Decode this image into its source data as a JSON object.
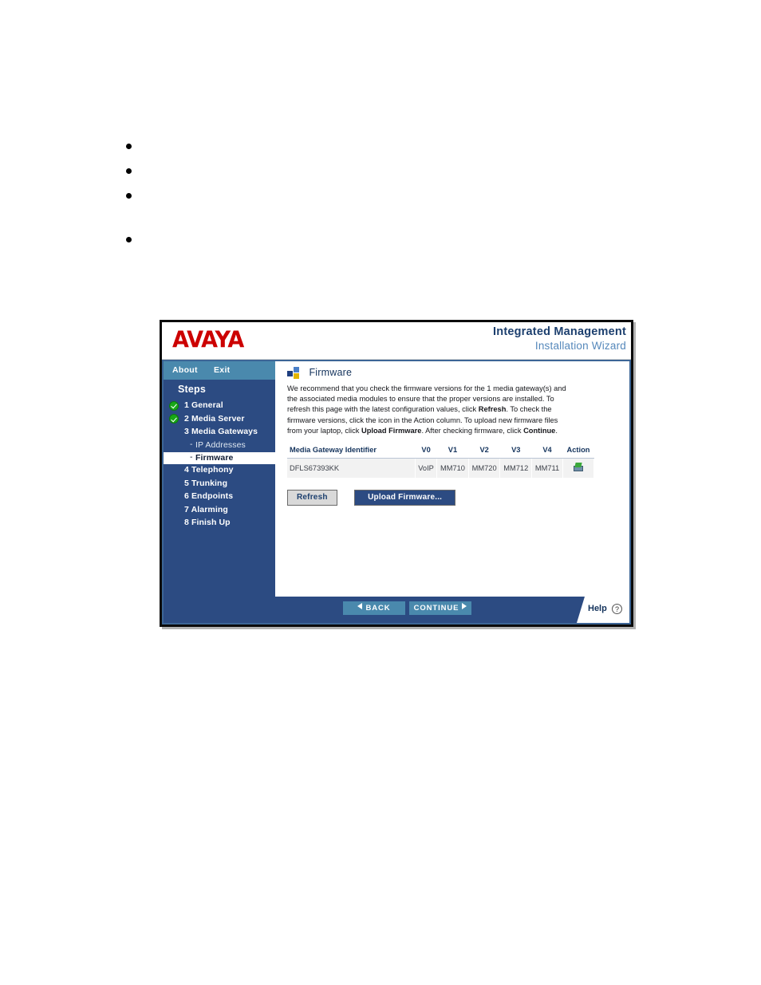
{
  "document": {
    "bullets": [
      "",
      "",
      "",
      ""
    ]
  },
  "window": {
    "brand": {
      "logo_text": "AVAYA",
      "product_line1": "Integrated Management",
      "product_line2": "Installation Wizard"
    },
    "topnav": {
      "about_label": "About",
      "exit_label": "Exit"
    },
    "sidebar": {
      "heading": "Steps",
      "items": [
        {
          "label": "1 General",
          "state": "complete",
          "sub": false
        },
        {
          "label": "2 Media Server",
          "state": "complete",
          "sub": false
        },
        {
          "label": "3 Media Gateways",
          "state": "normal",
          "sub": false
        },
        {
          "label": "IP Addresses",
          "state": "normal",
          "sub": true
        },
        {
          "label": "Firmware",
          "state": "active",
          "sub": true
        },
        {
          "label": "4 Telephony",
          "state": "normal",
          "sub": false
        },
        {
          "label": "5 Trunking",
          "state": "normal",
          "sub": false
        },
        {
          "label": "6 Endpoints",
          "state": "normal",
          "sub": false
        },
        {
          "label": "7 Alarming",
          "state": "normal",
          "sub": false
        },
        {
          "label": "8 Finish Up",
          "state": "normal",
          "sub": false
        }
      ]
    },
    "content": {
      "page_title": "Firmware",
      "page_icon": "firmware-squares-icon",
      "description_plain": "We recommend that you check the firmware versions for the 1 media gateway(s) and the associated media modules to ensure that the proper versions are installed. To refresh this page with the latest configuration values, click Refresh. To check the firmware versions, click the icon in the Action column. To upload new firmware files from your laptop, click Upload Firmware. After checking firmware, click Continue.",
      "description_runs": [
        {
          "text": "We recommend that you check the firmware versions for the 1 media gateway(s) and the associated media modules to ensure that the proper versions are installed. To refresh this page with the latest configuration values, click ",
          "bold": false
        },
        {
          "text": "Refresh",
          "bold": true
        },
        {
          "text": ". To check the firmware versions, click the icon in the Action column. To upload new firmware files from your laptop, click ",
          "bold": false
        },
        {
          "text": "Upload Firmware",
          "bold": true
        },
        {
          "text": ". After checking firmware, click ",
          "bold": false
        },
        {
          "text": "Continue",
          "bold": true
        },
        {
          "text": ".",
          "bold": false
        }
      ],
      "table": {
        "headers": [
          "Media Gateway Identifier",
          "V0",
          "V1",
          "V2",
          "V3",
          "V4",
          "Action"
        ],
        "rows": [
          {
            "identifier": "DFLS67393KK",
            "v0": "VoIP",
            "v1": "MM710",
            "v2": "MM720",
            "v3": "MM712",
            "v4": "MM711",
            "action_icon": "media-module-chip-icon"
          }
        ]
      },
      "buttons": {
        "refresh": "Refresh",
        "upload_firmware": "Upload Firmware..."
      }
    },
    "footer": {
      "back_label": "BACK",
      "continue_label": "CONTINUE",
      "help_label": "Help",
      "help_glyph": "?"
    },
    "colors": {
      "avaya_red": "#cc0000",
      "sidebar_blue": "#2c4b82",
      "accent_blue": "#4a89ad",
      "title_navy": "#1c3f6e",
      "subtitle_blue": "#5588bb",
      "check_green": "#18a818",
      "table_row_gray": "#f2f2f2"
    }
  }
}
